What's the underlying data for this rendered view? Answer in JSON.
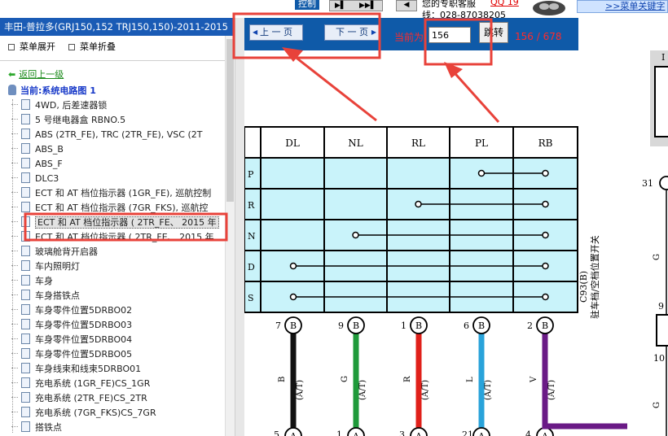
{
  "top_strip": {
    "control_label": "控制",
    "service_text": "您的专职客服",
    "qq_text": "QQ 19",
    "phone_text": "线：028-87038205",
    "menu_link": ">>菜单关键字"
  },
  "left": {
    "title": "丰田-普拉多(GRJ150,152 TRJ150,150)-2011-2015",
    "expand_label": "菜单展开",
    "collapse_label": "菜单折叠",
    "back_label": "返回上一级",
    "current_label": "当前:系统电路图 1",
    "items": [
      "4WD, 后差速器锁",
      "5 号继电器盒 RBNO.5",
      "ABS (2TR_FE), TRC (2TR_FE), VSC (2T",
      "ABS_B",
      "ABS_F",
      "DLC3",
      "ECT 和 AT 档位指示器 (1GR_FE), 巡航控制",
      "ECT 和 AT 档位指示器 (7GR_FKS), 巡航控",
      "ECT 和 AT 档位指示器 ( 2TR_FE、 2015 年",
      "ECT 和 AT 档位指示器 ( 2TR_FE、 2015 年",
      "玻璃舱背开启器",
      "车内照明灯",
      "车身",
      "车身搭铁点",
      "车身零件位置5DRBO02",
      "车身零件位置5DRBO03",
      "车身零件位置5DRBO04",
      "车身零件位置5DRBO05",
      "车身线束和线束5DRBO01",
      "充电系统 (1GR_FE)CS_1GR",
      "充电系统 (2TR_FE)CS_2TR",
      "充电系统 (7GR_FKS)CS_7GR",
      "搭铁点"
    ],
    "selected_index": 8
  },
  "toolbar": {
    "prev_label": "上 一 页",
    "next_label": "下 一 页",
    "current_label": "当前为",
    "page_value": "156",
    "jump_label": "跳转",
    "page_info": "156 / 678"
  },
  "diagram": {
    "columns": [
      "DL",
      "NL",
      "RL",
      "PL",
      "RB"
    ],
    "row_letters": [
      "P",
      "R",
      "N",
      "D",
      "S"
    ],
    "component_code": "C93(B)",
    "component_name": "驻车档/空档位置开关",
    "top_pins": [
      "7",
      "9",
      "1",
      "6",
      "2"
    ],
    "connector_top": "B",
    "connector_bottom": "A",
    "wire_colors": [
      "B",
      "G",
      "R",
      "L",
      "V"
    ],
    "wire_note": "(A/T)",
    "bottom_pins": [
      "5",
      "1",
      "3",
      "21",
      "4"
    ],
    "right_labels": [
      "31",
      "G",
      "9",
      "10",
      "G"
    ],
    "right_top_letter": "I",
    "colors": {
      "black": "#111111",
      "green": "#1f9a3a",
      "red": "#e0201a",
      "blue": "#29a3da",
      "purple": "#6a1a86",
      "grid_bg": "#c9f3fa",
      "annotation": "#e8423a"
    }
  }
}
